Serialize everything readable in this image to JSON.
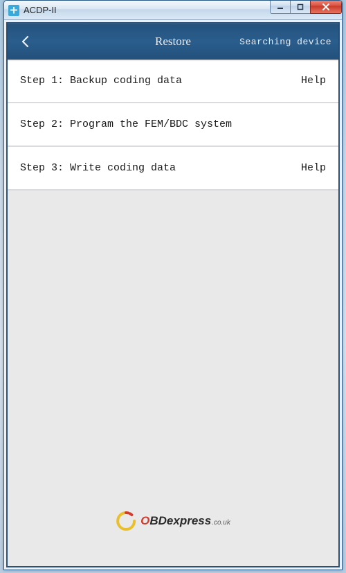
{
  "window": {
    "title": "ACDP-II"
  },
  "header": {
    "page_title": "Restore",
    "status": "Searching device"
  },
  "steps": [
    {
      "label": "Step 1: Backup coding data",
      "help": "Help"
    },
    {
      "label": "Step 2: Program the FEM/BDC system",
      "help": ""
    },
    {
      "label": "Step 3: Write coding data",
      "help": "Help"
    }
  ],
  "watermark": {
    "brand_first": "O",
    "brand_rest": "BDexpress",
    "suffix": ".co.uk"
  }
}
